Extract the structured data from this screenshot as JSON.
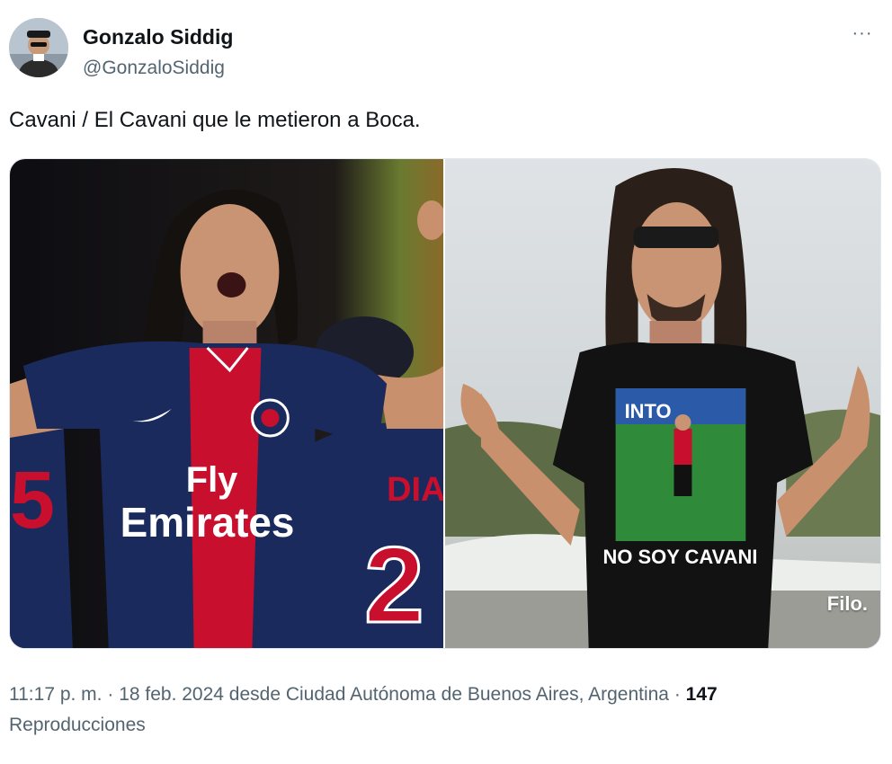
{
  "tweet": {
    "author_name": "Gonzalo Siddig",
    "author_handle": "@GonzaloSiddig",
    "more_icon": "···",
    "text": "Cavani / El Cavani que le metieron a Boca.",
    "time": "11:17 p. m.",
    "separator": " · ",
    "date": "18 feb. 2024",
    "location": " desde Ciudad Autónoma de Buenos Aires, Argentina",
    "separator2": " · ",
    "views_count": "147",
    "views_label": "Reproducciones"
  },
  "media": {
    "left_photo": {
      "sponsor_line1": "Fly",
      "sponsor_line2": "Emirates",
      "teammate_name": "DIA",
      "teammate_number": "2",
      "left_number": "5"
    },
    "right_photo": {
      "shirt_print_top": "INTO",
      "shirt_text": "NO SOY CAVANI",
      "watermark": "Filo."
    }
  },
  "colors": {
    "text_primary": "#0f1419",
    "text_secondary": "#536471",
    "psg_navy": "#1b2a5c",
    "psg_red": "#c8102e"
  }
}
